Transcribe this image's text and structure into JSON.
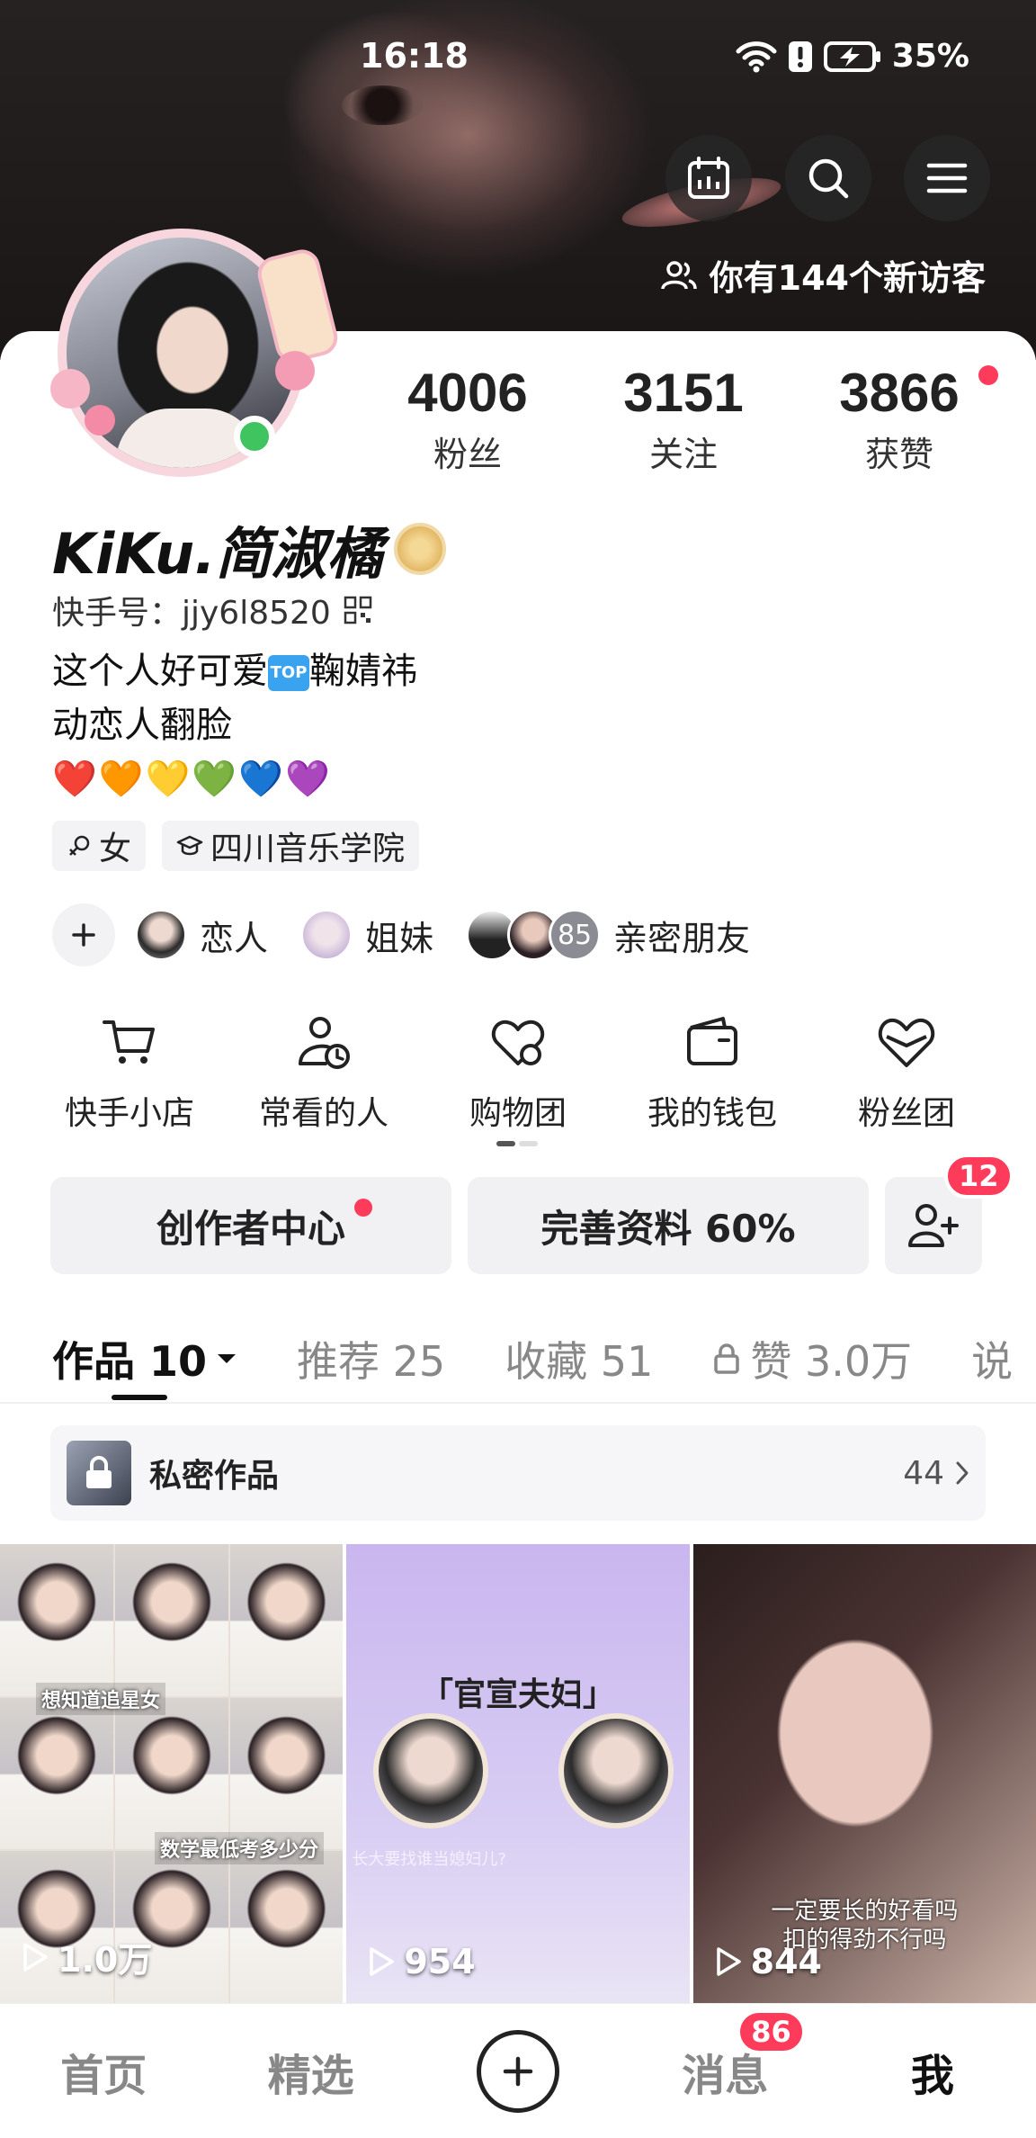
{
  "status_bar": {
    "time": "16:18",
    "battery": "35%"
  },
  "header": {
    "visitor_text": "你有144个新访客"
  },
  "profile": {
    "name": "KiKu.简淑橘",
    "id_label": "快手号：jjy6l8520",
    "bio_line1_a": "这个人好可爱",
    "bio_top_label": "TOP",
    "bio_line1_b": "鞠婧祎",
    "bio_line2": "动恋人翻脸",
    "hearts": "❤️🧡💛💚💙💜",
    "tags": [
      {
        "icon": "gender-female-icon",
        "label": "女"
      },
      {
        "icon": "graduation-cap-icon",
        "label": "四川音乐学院"
      }
    ],
    "relations": [
      {
        "label": "恋人"
      },
      {
        "label": "姐妹"
      },
      {
        "label": "亲密朋友",
        "count": "85"
      }
    ]
  },
  "stats": [
    {
      "value": "4006",
      "label": "粉丝"
    },
    {
      "value": "3151",
      "label": "关注"
    },
    {
      "value": "3866",
      "label": "获赞"
    }
  ],
  "services": [
    {
      "label": "快手小店",
      "icon": "cart-icon"
    },
    {
      "label": "常看的人",
      "icon": "person-clock-icon"
    },
    {
      "label": "购物团",
      "icon": "heart-bag-icon"
    },
    {
      "label": "我的钱包",
      "icon": "wallet-icon"
    },
    {
      "label": "粉丝团",
      "icon": "fan-heart-icon"
    }
  ],
  "actions": {
    "creator_center": "创作者中心",
    "complete_profile": "完善资料 60%",
    "friend_badge": "12"
  },
  "tabs": [
    {
      "label": "作品 10",
      "active": true
    },
    {
      "label": "推荐 25"
    },
    {
      "label": "收藏 51"
    },
    {
      "label": "赞 3.0万",
      "locked": true
    },
    {
      "label": "说"
    }
  ],
  "private_works": {
    "label": "私密作品",
    "count": "44"
  },
  "videos": [
    {
      "plays": "1.0万",
      "captions": [
        "想知道追星女",
        "数学最低考多少分"
      ]
    },
    {
      "plays": "954",
      "title": "「官宣夫妇」",
      "subtitle": "长大要找谁当媳妇儿?"
    },
    {
      "plays": "844",
      "caption_line1": "一定要长的好看吗",
      "caption_line2": "扣的得劲不行吗"
    }
  ],
  "bottom_nav": [
    {
      "label": "首页"
    },
    {
      "label": "精选"
    },
    {
      "label": "",
      "icon": "plus-icon"
    },
    {
      "label": "消息",
      "badge": "86"
    },
    {
      "label": "我",
      "active": true
    }
  ]
}
